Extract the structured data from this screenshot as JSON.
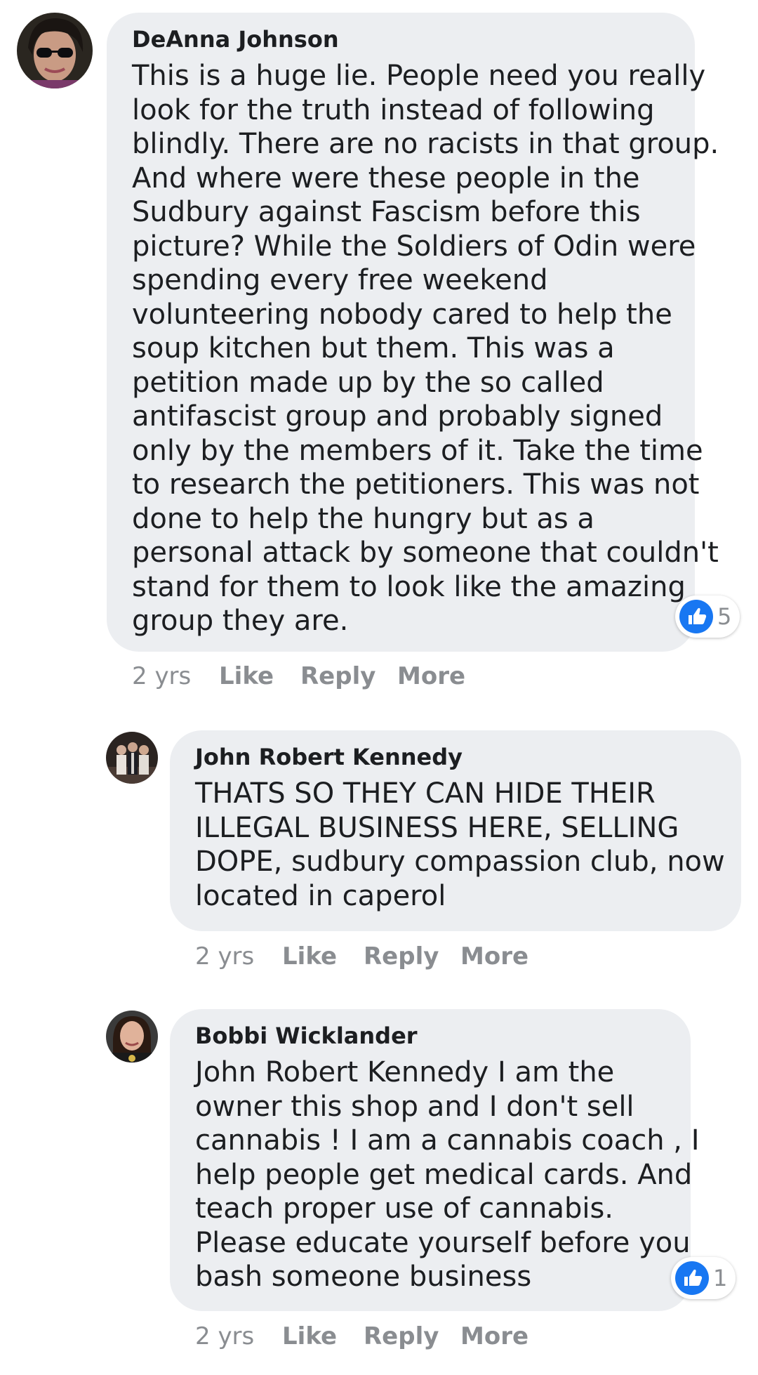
{
  "colors": {
    "bubble_bg": "#eceef1",
    "text": "#1c1e21",
    "meta_text": "#8a8d91",
    "like_blue": "#1877f2"
  },
  "comments": [
    {
      "author": "DeAnna Johnson",
      "avatar_icon": "avatar-woman-sunglasses",
      "lines": [
        "This is a huge lie. People need you really",
        "look for the truth instead of following",
        "blindly. There are no racists in that group.",
        "And where were these people in the",
        "Sudbury against Fascism before this",
        "picture? While the Soldiers of Odin were",
        "spending every free weekend",
        "volunteering nobody cared to help the",
        "soup kitchen but them. This was a",
        "petition made up by the so called",
        "antifascist group and probably signed",
        "only by the members of it. Take the time",
        "to research the petitioners. This was not",
        "done to help the hungry but as a",
        "personal attack by someone that couldn't",
        "stand for them to look like the amazing",
        "group they are."
      ],
      "reaction_icon": "like-icon",
      "reaction_count": "5",
      "time": "2 yrs",
      "like_label": "Like",
      "reply_label": "Reply",
      "more_label": "More"
    },
    {
      "author": "John Robert Kennedy",
      "avatar_icon": "avatar-group-photo",
      "lines": [
        "THATS SO THEY CAN HIDE THEIR",
        "ILLEGAL BUSINESS HERE, SELLING",
        "DOPE, sudbury compassion club, now",
        "located in caperol"
      ],
      "time": "2 yrs",
      "like_label": "Like",
      "reply_label": "Reply",
      "more_label": "More"
    },
    {
      "author": "Bobbi Wicklander",
      "avatar_icon": "avatar-woman-smiling",
      "lines": [
        "John Robert Kennedy I am the",
        "owner this shop and I don't sell",
        "cannabis ! I am a cannabis coach , I",
        "help people get medical cards. And",
        "teach proper use of cannabis.",
        "Please educate yourself before you",
        "bash someone business"
      ],
      "reaction_icon": "like-icon",
      "reaction_count": "1",
      "time": "2 yrs",
      "like_label": "Like",
      "reply_label": "Reply",
      "more_label": "More"
    }
  ]
}
